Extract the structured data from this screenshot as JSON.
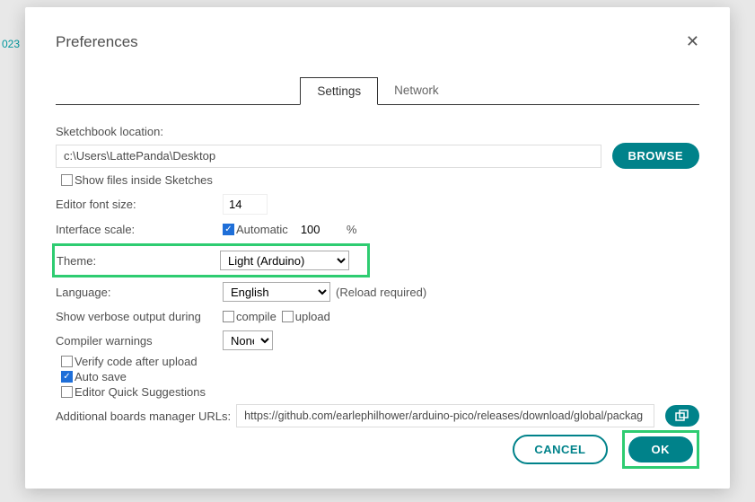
{
  "backdrop_hint": "023",
  "dialog": {
    "title": "Preferences",
    "tabs": {
      "settings": "Settings",
      "network": "Network"
    }
  },
  "sketchbook": {
    "label": "Sketchbook location:",
    "value": "c:\\Users\\LattePanda\\Desktop",
    "browse": "BROWSE",
    "show_files": "Show files inside Sketches"
  },
  "editor_font": {
    "label": "Editor font size:",
    "value": "14"
  },
  "interface_scale": {
    "label": "Interface scale:",
    "auto": "Automatic",
    "value": "100",
    "pct": "%"
  },
  "theme": {
    "label": "Theme:",
    "value": "Light (Arduino)"
  },
  "language": {
    "label": "Language:",
    "value": "English",
    "reload": "(Reload required)"
  },
  "verbose": {
    "label": "Show verbose output during",
    "compile": "compile",
    "upload": "upload"
  },
  "warnings": {
    "label": "Compiler warnings",
    "value": "None"
  },
  "extras": {
    "verify": "Verify code after upload",
    "autosave": "Auto save",
    "quick": "Editor Quick Suggestions"
  },
  "urls": {
    "label": "Additional boards manager URLs:",
    "value": "https://github.com/earlephilhower/arduino-pico/releases/download/global/packag"
  },
  "footer": {
    "cancel": "CANCEL",
    "ok": "OK"
  }
}
